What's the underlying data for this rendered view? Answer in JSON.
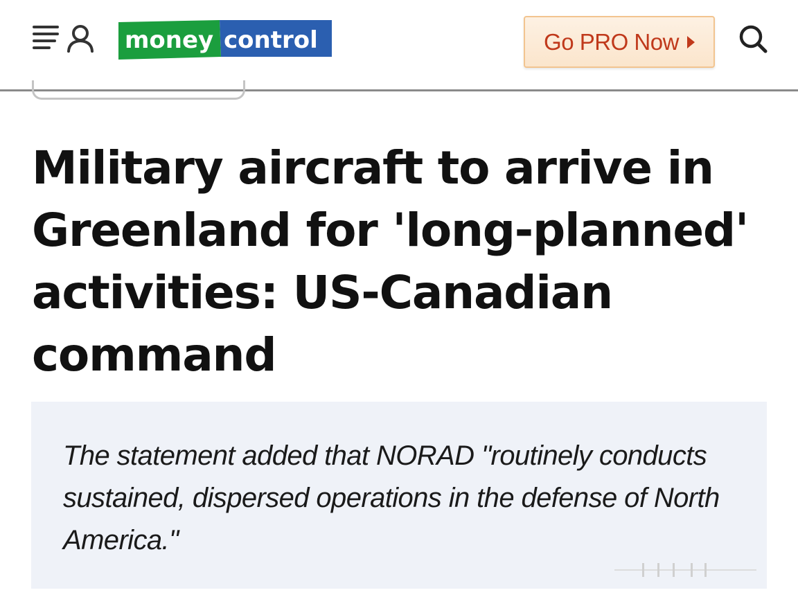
{
  "header": {
    "menu_icon": "menu-lines-icon",
    "user_icon": "user-icon",
    "logo": {
      "part1": "money",
      "part2": "control",
      "colors": {
        "green": "#1b9e3e",
        "blue": "#2b5fb0"
      }
    },
    "cta_label": "Go PRO Now",
    "cta_arrow_icon": "caret-right-icon",
    "search_icon": "search-icon",
    "accent_color": "#c0391b"
  },
  "article": {
    "headline": "Military aircraft to arrive in Greenland for 'long-planned' activities: US-Canadian command",
    "quote": "The statement added that NORAD \"routinely conducts sustained, dispersed operations in the defense of North America.\""
  }
}
